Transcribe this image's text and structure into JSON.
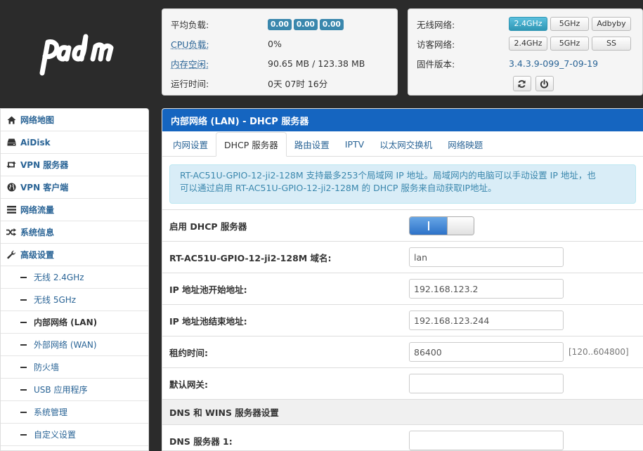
{
  "brand": {
    "logo_text": "padavan"
  },
  "status": {
    "load_label": "平均负载:",
    "load_values": [
      "0.00",
      "0.00",
      "0.00"
    ],
    "cpu_label": "CPU负载:",
    "cpu_value": "0%",
    "mem_label": "内存空闲:",
    "mem_value": "90.65 MB / 123.38 MB",
    "uptime_label": "运行时间:",
    "uptime_value": "0天 07时 16分"
  },
  "wireless": {
    "wifi_label": "无线网络:",
    "wifi_buttons": [
      "2.4GHz",
      "5GHz",
      "Adbyby"
    ],
    "guest_label": "访客网络:",
    "guest_buttons": [
      "2.4GHz",
      "5GHz",
      "SS"
    ],
    "firmware_label": "固件版本:",
    "firmware_value": "3.4.3.9-099_7-09-19"
  },
  "sidebar": {
    "items": [
      {
        "label": "网络地图",
        "icon": "home-icon"
      },
      {
        "label": "AiDisk",
        "icon": "hdd-icon"
      },
      {
        "label": "VPN 服务器",
        "icon": "retweet-icon"
      },
      {
        "label": "VPN 客户端",
        "icon": "globe-icon"
      },
      {
        "label": "网络流量",
        "icon": "list-icon"
      },
      {
        "label": "系统信息",
        "icon": "random-icon"
      },
      {
        "label": "高级设置",
        "icon": "wrench-icon"
      }
    ],
    "subitems": [
      "无线 2.4GHz",
      "无线 5GHz",
      "内部网络 (LAN)",
      "外部网络 (WAN)",
      "防火墙",
      "USB 应用程序",
      "系统管理",
      "自定义设置"
    ]
  },
  "main": {
    "title": "内部网络 (LAN) - DHCP 服务器",
    "tabs": [
      "内网设置",
      "DHCP 服务器",
      "路由设置",
      "IPTV",
      "以太网交换机",
      "网络映题"
    ],
    "info_line1": "RT-AC51U-GPIO-12-ji2-128M 支持最多253个局域网 IP 地址。局域网内的电脑可以手动设置 IP 地址，也",
    "info_line2": "可以通过启用 RT-AC51U-GPIO-12-ji2-128M 的 DHCP 服务来自动获取IP地址。",
    "fields": {
      "dhcp_enable_label": "启用 DHCP 服务器",
      "domain_label": "RT-AC51U-GPIO-12-ji2-128M 域名:",
      "domain_value": "lan",
      "start_label": "IP 地址池开始地址:",
      "start_value": "192.168.123.2",
      "end_label": "IP 地址池结束地址:",
      "end_value": "192.168.123.244",
      "lease_label": "租约时间:",
      "lease_value": "86400",
      "lease_hint": "[120..604800]",
      "gateway_label": "默认网关:",
      "gateway_value": ""
    },
    "dns_section_title": "DNS 和 WINS 服务器设置",
    "dns1_label": "DNS 服务器 1:",
    "dns1_value": ""
  }
}
